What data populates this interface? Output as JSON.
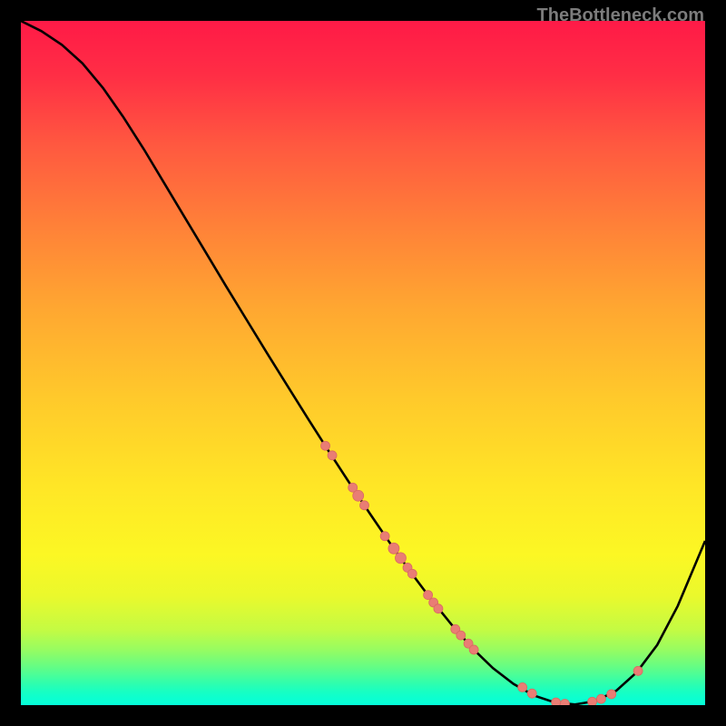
{
  "watermark": "TheBottleneck.com",
  "colors": {
    "background": "#000000",
    "curve": "#000000",
    "marker_fill": "#e97d74",
    "marker_stroke": "#d96a62",
    "watermark": "#7c7c7c"
  },
  "chart_data": {
    "type": "line",
    "title": "",
    "xlabel": "",
    "ylabel": "",
    "xlim": [
      0,
      100
    ],
    "ylim": [
      0,
      100
    ],
    "grid": false,
    "legend": false,
    "curve_points": [
      {
        "x": 0.0,
        "y": 100.0
      },
      {
        "x": 3.0,
        "y": 98.5
      },
      {
        "x": 6.0,
        "y": 96.5
      },
      {
        "x": 9.0,
        "y": 93.8
      },
      {
        "x": 12.0,
        "y": 90.2
      },
      {
        "x": 15.0,
        "y": 85.9
      },
      {
        "x": 18.0,
        "y": 81.2
      },
      {
        "x": 21.0,
        "y": 76.2
      },
      {
        "x": 24.0,
        "y": 71.2
      },
      {
        "x": 27.0,
        "y": 66.2
      },
      {
        "x": 30.0,
        "y": 61.2
      },
      {
        "x": 33.0,
        "y": 56.3
      },
      {
        "x": 36.0,
        "y": 51.4
      },
      {
        "x": 39.0,
        "y": 46.6
      },
      {
        "x": 42.0,
        "y": 41.8
      },
      {
        "x": 45.0,
        "y": 37.1
      },
      {
        "x": 48.0,
        "y": 32.5
      },
      {
        "x": 51.0,
        "y": 28.0
      },
      {
        "x": 54.0,
        "y": 23.6
      },
      {
        "x": 57.0,
        "y": 19.4
      },
      {
        "x": 60.0,
        "y": 15.4
      },
      {
        "x": 63.0,
        "y": 11.7
      },
      {
        "x": 66.0,
        "y": 8.3
      },
      {
        "x": 69.0,
        "y": 5.4
      },
      {
        "x": 72.0,
        "y": 3.1
      },
      {
        "x": 75.0,
        "y": 1.4
      },
      {
        "x": 78.0,
        "y": 0.4
      },
      {
        "x": 81.0,
        "y": 0.1
      },
      {
        "x": 84.0,
        "y": 0.6
      },
      {
        "x": 87.0,
        "y": 2.1
      },
      {
        "x": 90.0,
        "y": 4.8
      },
      {
        "x": 93.0,
        "y": 8.8
      },
      {
        "x": 96.0,
        "y": 14.5
      },
      {
        "x": 100.0,
        "y": 24.0
      }
    ],
    "markers": [
      {
        "x": 44.5,
        "y": 37.9,
        "r": 5
      },
      {
        "x": 45.5,
        "y": 36.5,
        "r": 5
      },
      {
        "x": 48.5,
        "y": 31.8,
        "r": 5
      },
      {
        "x": 49.3,
        "y": 30.6,
        "r": 6
      },
      {
        "x": 50.2,
        "y": 29.2,
        "r": 5
      },
      {
        "x": 53.2,
        "y": 24.7,
        "r": 5
      },
      {
        "x": 54.5,
        "y": 22.9,
        "r": 6
      },
      {
        "x": 55.5,
        "y": 21.5,
        "r": 6
      },
      {
        "x": 56.5,
        "y": 20.1,
        "r": 5
      },
      {
        "x": 57.2,
        "y": 19.2,
        "r": 5
      },
      {
        "x": 59.5,
        "y": 16.1,
        "r": 5
      },
      {
        "x": 60.3,
        "y": 15.0,
        "r": 5
      },
      {
        "x": 61.0,
        "y": 14.1,
        "r": 5
      },
      {
        "x": 63.5,
        "y": 11.1,
        "r": 5
      },
      {
        "x": 64.3,
        "y": 10.2,
        "r": 5
      },
      {
        "x": 65.4,
        "y": 9.0,
        "r": 5
      },
      {
        "x": 66.2,
        "y": 8.1,
        "r": 5
      },
      {
        "x": 73.3,
        "y": 2.6,
        "r": 5
      },
      {
        "x": 74.7,
        "y": 1.7,
        "r": 5
      },
      {
        "x": 78.2,
        "y": 0.4,
        "r": 5
      },
      {
        "x": 79.5,
        "y": 0.2,
        "r": 5
      },
      {
        "x": 83.5,
        "y": 0.5,
        "r": 5
      },
      {
        "x": 84.8,
        "y": 0.9,
        "r": 5
      },
      {
        "x": 86.3,
        "y": 1.6,
        "r": 5
      },
      {
        "x": 90.2,
        "y": 5.0,
        "r": 5
      }
    ]
  }
}
